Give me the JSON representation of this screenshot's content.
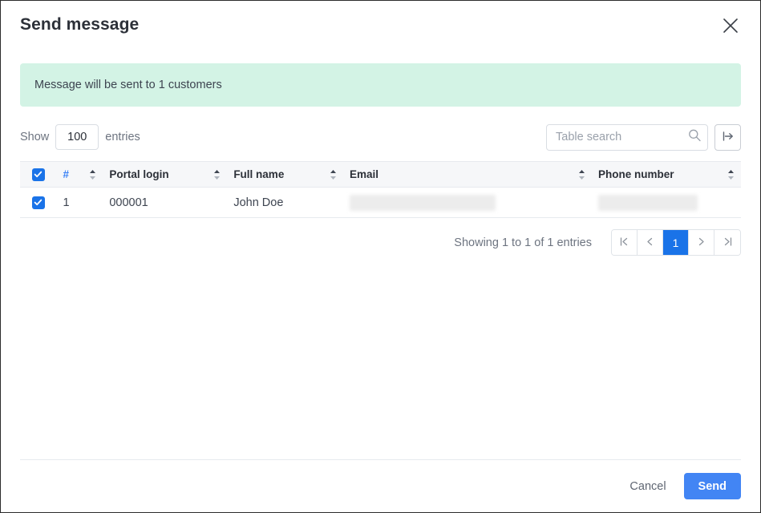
{
  "dialog": {
    "title": "Send message",
    "close_icon": "close-icon"
  },
  "alert": {
    "message": "Message will be sent to 1 customers",
    "background": "#d3f3e5"
  },
  "controls": {
    "show_label": "Show",
    "entries_label": "entries",
    "page_length": "100",
    "search_placeholder": "Table search",
    "search_value": "",
    "search_icon": "search-icon",
    "export_icon": "export-icon"
  },
  "table": {
    "columns": [
      {
        "label": "",
        "name": "select-all"
      },
      {
        "label": "#",
        "name": "row-number"
      },
      {
        "label": "Portal login",
        "name": "portal-login"
      },
      {
        "label": "Full name",
        "name": "full-name"
      },
      {
        "label": "Email",
        "name": "email"
      },
      {
        "label": "Phone number",
        "name": "phone-number"
      }
    ],
    "rows": [
      {
        "selected": true,
        "number": "1",
        "portal_login": "000001",
        "full_name": "John Doe",
        "email": "",
        "phone_number": ""
      }
    ],
    "showing_info": "Showing 1 to 1 of 1 entries",
    "pagination": {
      "first_label": "|<",
      "prev_label": "<",
      "pages": [
        "1"
      ],
      "active_page": "1",
      "next_label": ">",
      "last_label": ">|"
    }
  },
  "footer": {
    "cancel_label": "Cancel",
    "send_label": "Send"
  },
  "colors": {
    "accent_blue": "#4285f4",
    "checkbox_blue": "#1a73e8",
    "alert_green": "#d3f3e5",
    "header_bg": "#f6f7f9"
  }
}
